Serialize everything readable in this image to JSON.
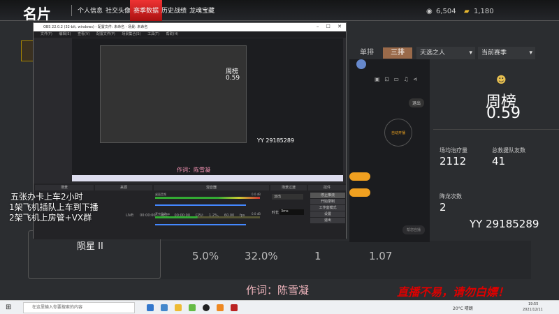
{
  "header": {
    "title": "名片",
    "nav": [
      "个人信息",
      "社交头像",
      "赛季数据",
      "历史战绩",
      "龙魂宝藏"
    ],
    "active": "赛季数据",
    "coins": "6,504",
    "gold": "1,180"
  },
  "obs": {
    "title": "OBS 22.0.2 (32-bit, windows) - 配置文件: 未命名 - 场景: 未命名",
    "menu": "文件(F) 编辑(E) 查看(V) 配置文件(P) 场景集合(S) 工具(T) 帮助(H)",
    "docks": {
      "scenes": "场景",
      "sources": "来源",
      "mixer": "混音器",
      "transitions": "场景过渡",
      "controls": "控件"
    },
    "mixer": {
      "desktop": "桌面音频",
      "desktop_db": "0.0 dB",
      "mic": "麦克风/Aux",
      "mic_db": "0.0 dB"
    },
    "transition": "淡出",
    "duration_label": "时长",
    "duration": "3ms",
    "controls": [
      "停止推流",
      "开始录制",
      "工作室模式",
      "设置",
      "退出"
    ],
    "status": "LIVE: 00:00:00   REC: 00:00:00   CPU: 1.2%, 60.00 fps"
  },
  "preview": {
    "credit": "作词：陈雪凝",
    "yy": "YY 29185289",
    "week": "周榜",
    "weekval": "0.59"
  },
  "panel": {
    "tabs": [
      "单排",
      "三排"
    ],
    "active_tab": "三排",
    "mode": "天选之人",
    "season": "当前赛季",
    "week_label": "周榜",
    "week_value": "0.59",
    "stats": [
      {
        "label": "场均治疗量",
        "value": "2112"
      },
      {
        "label": "总救援队友数",
        "value": "41"
      },
      {
        "label": "降龙次数",
        "value": "2"
      }
    ],
    "bottom_stats": [
      "5.0%",
      "32.0%",
      "1",
      "1.07"
    ]
  },
  "app": {
    "exit": "退出",
    "auto": "自动开播",
    "assist": "帮您自播"
  },
  "overlay": {
    "lines": [
      "五张办卡上车2小时",
      "1架飞机插队上车到下播",
      "2架飞机上房管+VX群"
    ],
    "yy": "YY 29185289",
    "credit": "作词：陈雪凝",
    "warning": "直播不易，请勿白嫖！",
    "rank": "陨星 II"
  },
  "taskbar": {
    "search": "在这里输入你要搜索的内容",
    "weather": "20°C 晴朗",
    "time": "19:55",
    "date": "2021/12/11"
  }
}
